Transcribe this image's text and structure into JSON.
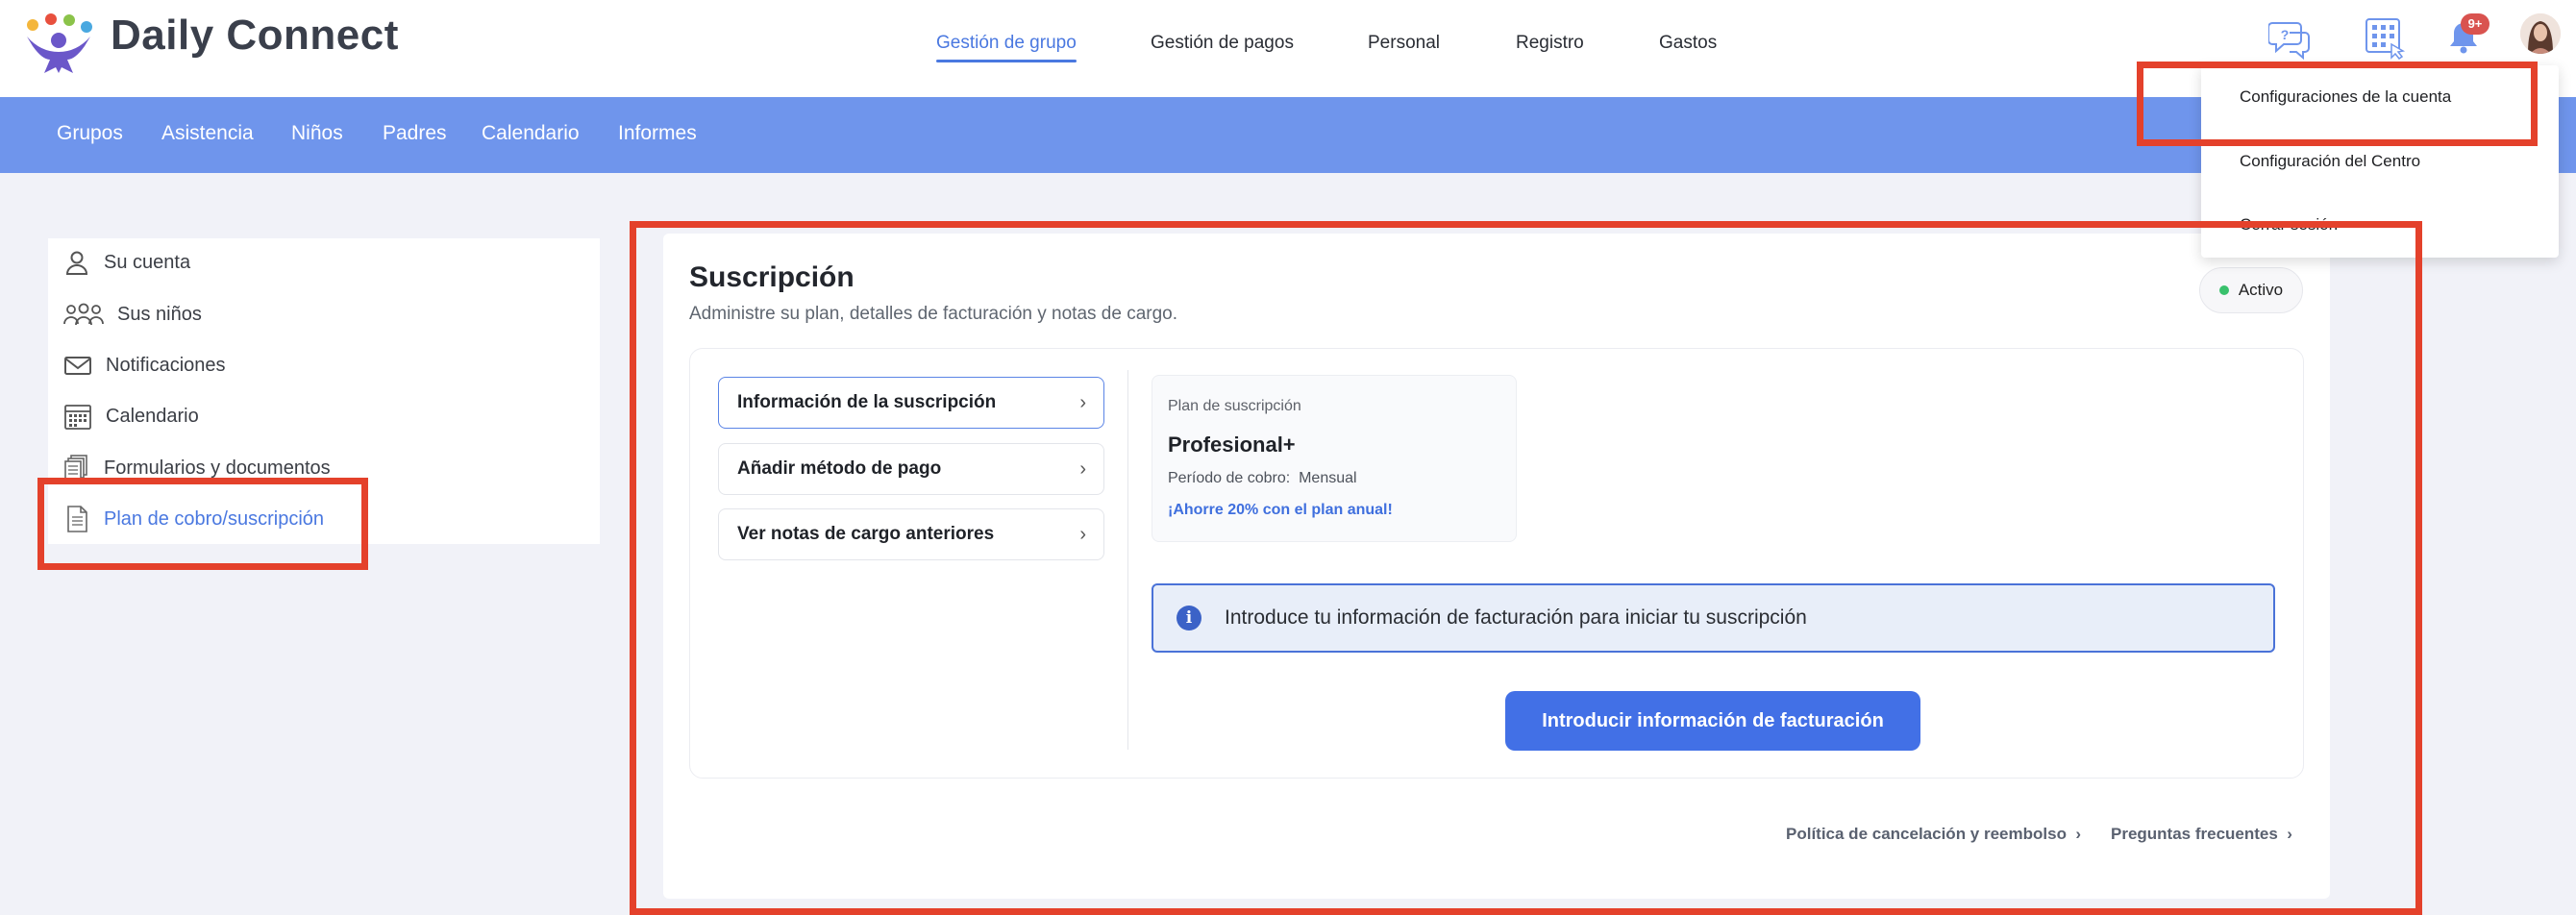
{
  "brand": {
    "name": "Daily Connect"
  },
  "header": {
    "nav": [
      {
        "label": "Gestión de grupo",
        "active": true
      },
      {
        "label": "Gestión de pagos"
      },
      {
        "label": "Personal"
      },
      {
        "label": "Registro"
      },
      {
        "label": "Gastos"
      }
    ],
    "icons": [
      "help-chat-icon",
      "apps-grid-icon",
      "notifications-bell-icon"
    ],
    "notification_badge": "9+"
  },
  "subnav": {
    "items": [
      "Grupos",
      "Asistencia",
      "Niños",
      "Padres",
      "Calendario",
      "Informes"
    ]
  },
  "account_menu": {
    "items": [
      "Configuraciones de la cuenta",
      "Configuración del Centro",
      "Cerrar sesión"
    ]
  },
  "sidebar": {
    "items": [
      {
        "label": "Su cuenta",
        "icon": "user-icon"
      },
      {
        "label": "Sus niños",
        "icon": "children-icon"
      },
      {
        "label": "Notificaciones",
        "icon": "envelope-icon"
      },
      {
        "label": "Calendario",
        "icon": "calendar-icon"
      },
      {
        "label": "Formularios y documentos",
        "icon": "documents-icon"
      },
      {
        "label": "Plan de cobro/suscripción",
        "icon": "invoice-icon",
        "active": true
      }
    ]
  },
  "subscription": {
    "title": "Suscripción",
    "subtitle": "Administre su plan, detalles de facturación y notas de cargo.",
    "status": "Activo",
    "menu": [
      "Información de la suscripción",
      "Añadir método de pago",
      "Ver notas de cargo anteriores"
    ],
    "plan": {
      "label": "Plan de suscripción",
      "name": "Profesional+",
      "period_label": "Período de cobro:",
      "period_value": "Mensual",
      "promo": "¡Ahorre 20% con el plan anual!"
    },
    "info_message": "Introduce tu información de facturación para iniciar tu suscripción",
    "cta_label": "Introducir información de facturación"
  },
  "footer_links": [
    "Política de cancelación y reembolso",
    "Preguntas frecuentes"
  ],
  "colors": {
    "accent": "#4270e6",
    "subnav": "#6f95ec",
    "highlight": "#e4412b",
    "status_active": "#39c16c"
  }
}
